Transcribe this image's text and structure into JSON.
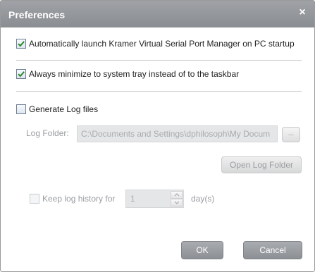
{
  "window": {
    "title": "Preferences",
    "close_glyph": "×"
  },
  "options": {
    "auto_launch": {
      "label": "Automatically launch Kramer Virtual Serial Port Manager on PC startup",
      "checked": true
    },
    "minimize_tray": {
      "label": "Always minimize to system tray instead of to the taskbar",
      "checked": true
    },
    "generate_logs": {
      "label": "Generate Log files",
      "checked": false
    }
  },
  "log_folder": {
    "label": "Log Folder:",
    "value": "C:\\Documents and Settings\\dphilosoph\\My Docum",
    "browse_label": "...",
    "open_button": "Open Log Folder"
  },
  "log_history": {
    "label": "Keep log history for",
    "value": "1",
    "unit": "day(s)",
    "checked": false
  },
  "footer": {
    "ok": "OK",
    "cancel": "Cancel"
  },
  "colors": {
    "titlebar": "#9a9da1",
    "check_mark": "#2e8b2e",
    "primary_button": "#8f9297"
  }
}
